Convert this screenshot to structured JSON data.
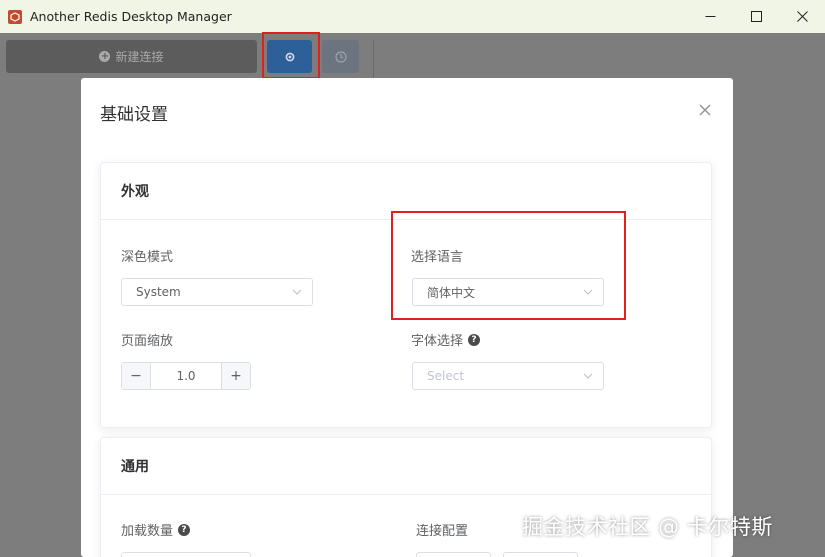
{
  "window": {
    "app_icon": "redis-logo-icon",
    "title": "Another Redis Desktop Manager",
    "controls": [
      "minimize-icon",
      "maximize-icon",
      "close-icon"
    ]
  },
  "toolbar": {
    "new_connection_label": "新建连接",
    "settings_icon": "gear-icon",
    "history_icon": "clock-icon"
  },
  "dialog": {
    "title": "基础设置",
    "appearance": {
      "header": "外观",
      "dark_mode": {
        "label": "深色模式",
        "value": "System"
      },
      "language": {
        "label": "选择语言",
        "value": "简体中文"
      },
      "zoom": {
        "label": "页面缩放",
        "value": "1.0",
        "minus": "−",
        "plus": "+"
      },
      "font": {
        "label": "字体选择",
        "help": "?",
        "placeholder": "Select"
      }
    },
    "general": {
      "header": "通用",
      "load_count": {
        "label": "加载数量",
        "help": "?"
      },
      "connection_config": {
        "label": "连接配置"
      }
    }
  },
  "watermark": "掘金技术社区 @ 卡尔特斯",
  "colors": {
    "highlight": "#e02020",
    "accent": "#2d5f99",
    "overlay": "#7d7d7d"
  }
}
